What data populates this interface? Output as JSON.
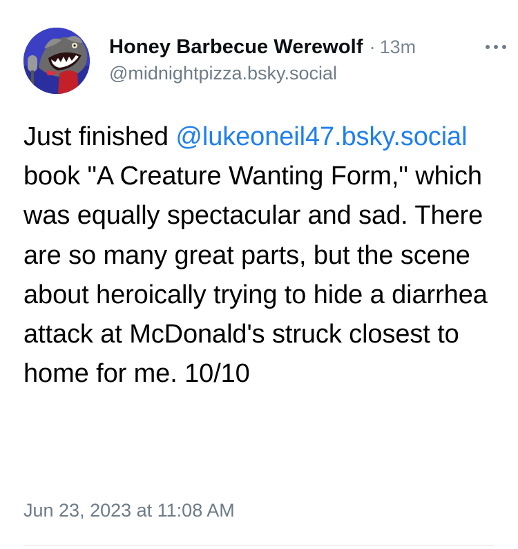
{
  "post": {
    "author": {
      "display_name": "Honey Barbecue Werewolf",
      "handle": "@midnightpizza.bsky.social",
      "avatar_icon": "werewolf-avatar"
    },
    "time_separator": "·",
    "time_ago": "13m",
    "more_icon": "ellipsis-icon",
    "body": {
      "before_mention": "Just finished ",
      "mention": "@lukeoneil47.bsky.social",
      "after_mention": " book \"A Creature Wanting Form,\" which was equally spectacular and sad. There are so many great parts, but the scene about heroically trying to hide a diarrhea attack at McDonald's struck closest to home for me. 10/10"
    },
    "timestamp": "Jun 23, 2023 at 11:08 AM"
  },
  "colors": {
    "mention": "#1f7ff0",
    "secondary_text": "#6e7b88",
    "primary_text": "#000000",
    "avatar_background": "#3a3fc4"
  }
}
